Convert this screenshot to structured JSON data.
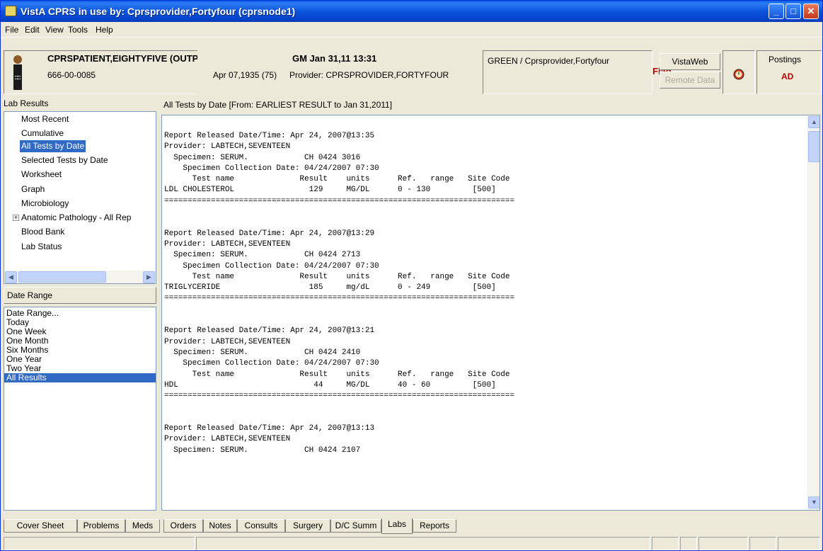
{
  "window": {
    "title": "VistA CPRS in use by: Cprsprovider,Fortyfour  (cprsnode1)"
  },
  "menu": [
    "File",
    "Edit",
    "View",
    "Tools",
    "Help"
  ],
  "patient": {
    "name": "CPRSPATIENT,EIGHTYFIVE (OUTPATIENT)",
    "ssn": "666-00-0085",
    "location": "GM Jan 31,11 13:31",
    "dob": "Apr 07,1935 (75)",
    "provider": "Provider:  CPRSPROVIDER,FORTYFOUR",
    "team": "GREEN / Cprsprovider,Fortyfour",
    "flag": "Flag",
    "vistaweb": "VistaWeb",
    "remote_data": "Remote Data",
    "postings_label": "Postings",
    "postings_value": "AD"
  },
  "lab_results": {
    "label": "Lab Results",
    "items": [
      "Most Recent",
      "Cumulative",
      "All Tests by Date",
      "Selected Tests by Date",
      "Worksheet",
      "Graph",
      "Microbiology",
      "Anatomic Pathology - All Rep",
      "Blood Bank",
      "Lab Status"
    ],
    "selected": "All Tests by Date"
  },
  "date_range": {
    "label": "Date Range",
    "items": [
      "Date Range...",
      "Today",
      "One Week",
      "One Month",
      "Six Months",
      "One Year",
      "Two Year",
      "All Results"
    ],
    "selected": "All Results"
  },
  "report": {
    "header": "All Tests by Date [From: EARLIEST RESULT to Jan 31,2011]",
    "text": "Report Released Date/Time: Apr 24, 2007@13:35\nProvider: LABTECH,SEVENTEEN\n  Specimen: SERUM.            CH 0424 3016\n    Specimen Collection Date: 04/24/2007 07:30\n      Test name              Result    units      Ref.   range   Site Code\nLDL CHOLESTEROL                129     MG/DL      0 - 130         [500]\n===========================================================================\n\n\nReport Released Date/Time: Apr 24, 2007@13:29\nProvider: LABTECH,SEVENTEEN\n  Specimen: SERUM.            CH 0424 2713\n    Specimen Collection Date: 04/24/2007 07:30\n      Test name              Result    units      Ref.   range   Site Code\nTRIGLYCERIDE                   185     mg/dL      0 - 249         [500]\n===========================================================================\n\n\nReport Released Date/Time: Apr 24, 2007@13:21\nProvider: LABTECH,SEVENTEEN\n  Specimen: SERUM.            CH 0424 2410\n    Specimen Collection Date: 04/24/2007 07:30\n      Test name              Result    units      Ref.   range   Site Code\nHDL                             44     MG/DL      40 - 60         [500]\n===========================================================================\n\n\nReport Released Date/Time: Apr 24, 2007@13:13\nProvider: LABTECH,SEVENTEEN\n  Specimen: SERUM.            CH 0424 2107"
  },
  "tabs": [
    "Cover Sheet",
    "Problems",
    "Meds",
    "Orders",
    "Notes",
    "Consults",
    "Surgery",
    "D/C Summ",
    "Labs",
    "Reports"
  ],
  "active_tab": "Labs"
}
